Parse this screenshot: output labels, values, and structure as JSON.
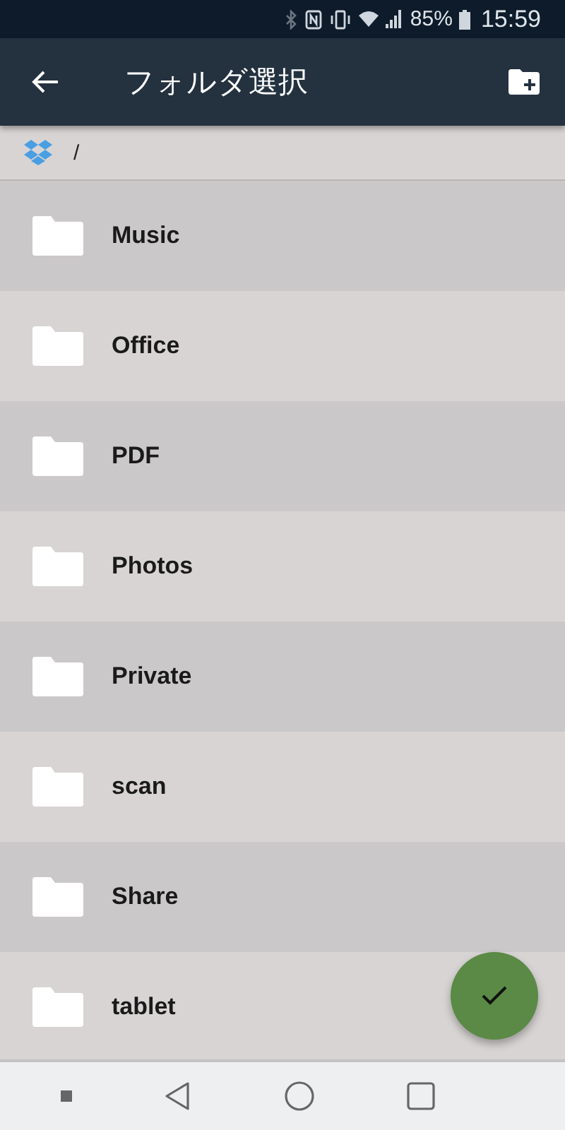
{
  "status_bar": {
    "battery": "85%",
    "time": "15:59"
  },
  "app_bar": {
    "title": "フォルダ選択"
  },
  "breadcrumb": {
    "path": "/"
  },
  "folders": [
    {
      "name": "Music"
    },
    {
      "name": "Office"
    },
    {
      "name": "PDF"
    },
    {
      "name": "Photos"
    },
    {
      "name": "Private"
    },
    {
      "name": "scan"
    },
    {
      "name": "Share"
    },
    {
      "name": "tablet"
    }
  ]
}
